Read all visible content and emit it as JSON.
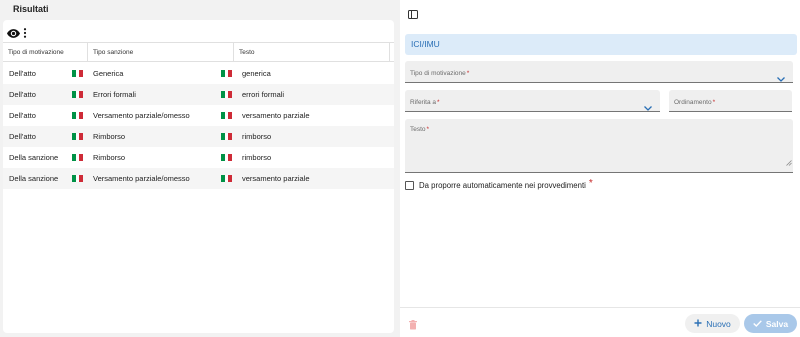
{
  "left": {
    "title": "Risultati",
    "columns": [
      "Tipo di motivazione",
      "Tipo sanzione",
      "Testo"
    ],
    "rows": [
      {
        "motivazione": "Dell'atto",
        "sanzione": "Generica",
        "testo": "generica"
      },
      {
        "motivazione": "Dell'atto",
        "sanzione": "Errori formali",
        "testo": "errori formali"
      },
      {
        "motivazione": "Dell'atto",
        "sanzione": "Versamento parziale/omesso",
        "testo": "versamento parziale"
      },
      {
        "motivazione": "Dell'atto",
        "sanzione": "Rimborso",
        "testo": "rimborso"
      },
      {
        "motivazione": "Della sanzione",
        "sanzione": "Rimborso",
        "testo": "rimborso"
      },
      {
        "motivazione": "Della sanzione",
        "sanzione": "Versamento parziale/omesso",
        "testo": "versamento parziale"
      }
    ],
    "icons": [
      "eye-icon",
      "more-vert-icon",
      "italy-flag-icon"
    ]
  },
  "form": {
    "banner": "ICI/IMU",
    "tipo_label": "Tipo di motivazione",
    "riferita_label": "Riferita a",
    "ordinamento_label": "Ordinamento",
    "testo_label": "Testo",
    "required_mark": "*",
    "checkbox_label": "Da proporre automaticamente nei provvedimenti",
    "checkbox_checked": false
  },
  "footer": {
    "new_label": "Nuovo",
    "save_label": "Salva",
    "icons": [
      "trash-icon",
      "plus-icon",
      "check-icon"
    ]
  },
  "colors": {
    "accent": "#2a6fb5",
    "banner_bg": "#dcebf9",
    "required": "#c62828",
    "save_disabled": "#a9c8e9",
    "flag_green": "#009246",
    "flag_white": "#ffffff",
    "flag_red": "#ce2b37"
  }
}
